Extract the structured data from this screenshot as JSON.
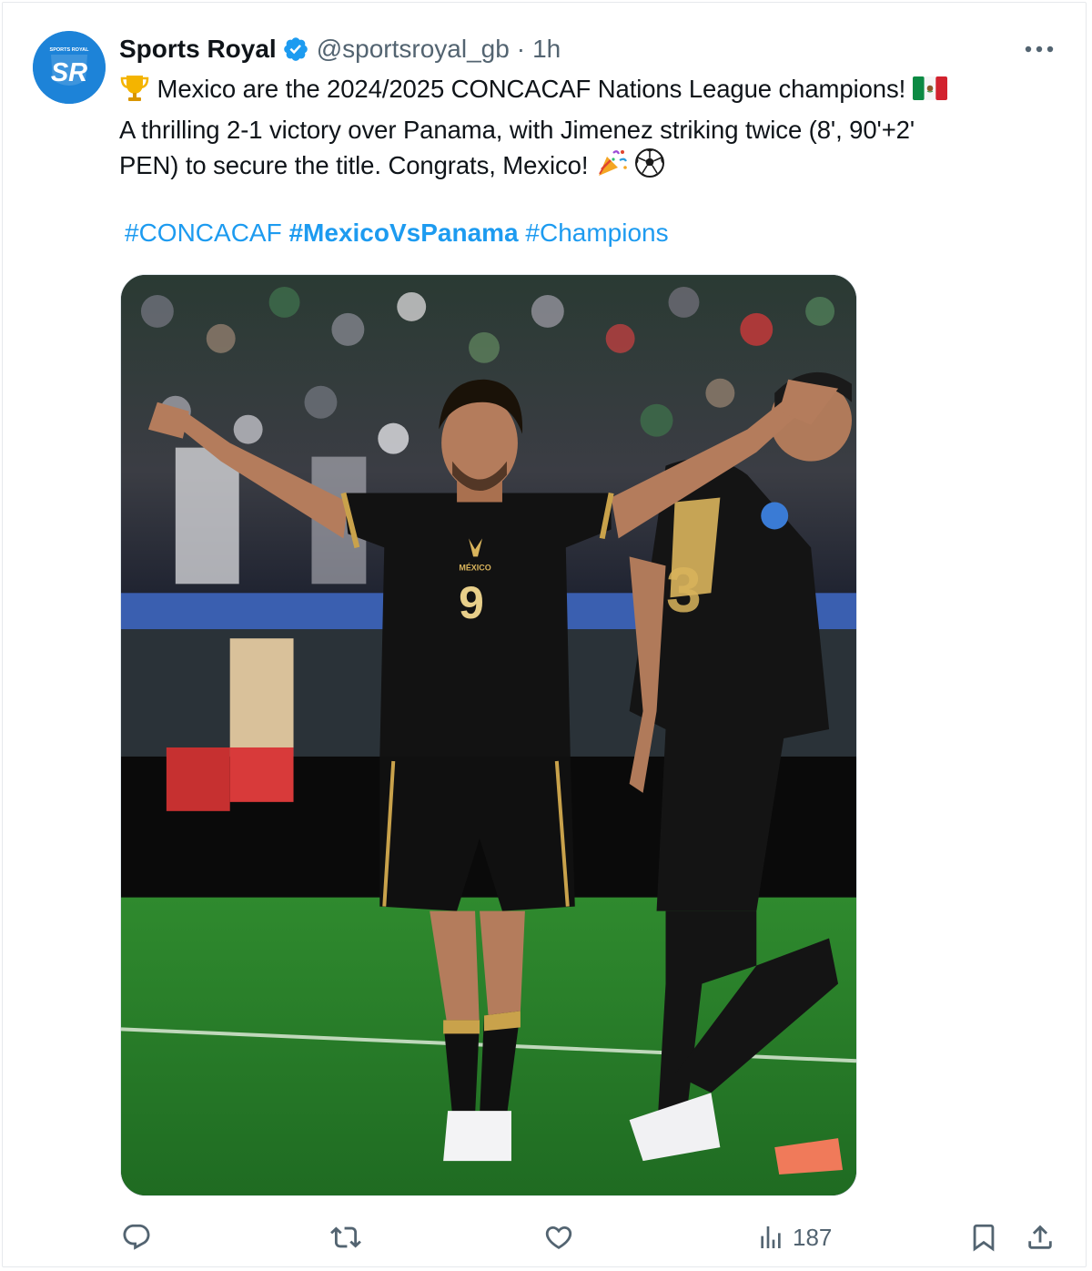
{
  "author": {
    "display_name": "Sports Royal",
    "handle": "@sportsroyal_gb",
    "separator": "·",
    "time": "1h",
    "avatar_text": "SR",
    "avatar_subtext": "SPORTS ROYAL",
    "verified_icon": "verified-badge-icon"
  },
  "tweet": {
    "line1_text": "Mexico are the 2024/2025 CONCACAF Nations League champions!",
    "line2_text": "A thrilling 2-1 victory over Panama, with Jimenez striking twice (8', 90'+2'",
    "line3_text": "PEN) to secure the title. Congrats, Mexico!",
    "emoji_trophy": "trophy-emoji",
    "emoji_flag": "mexico-flag-emoji",
    "emoji_party": "party-popper-emoji",
    "emoji_ball": "soccer-ball-emoji"
  },
  "hashtags": [
    {
      "text": "#CONCACAF"
    },
    {
      "text": "#MexicoVsPanama"
    },
    {
      "text": "#Champions"
    }
  ],
  "media": {
    "jersey_text": "MÉXICO",
    "jersey_number": "9",
    "teammate_number": "3"
  },
  "actions": {
    "reply_icon": "reply-icon",
    "retweet_icon": "retweet-icon",
    "like_icon": "heart-icon",
    "views_icon": "views-chart-icon",
    "views_count": "187",
    "bookmark_icon": "bookmark-icon",
    "share_icon": "share-icon"
  },
  "colors": {
    "link": "#1d9bf0",
    "text": "#0f1419",
    "secondary": "#536471",
    "avatar_bg": "#1d83d8",
    "verified": "#1d9bf0"
  }
}
